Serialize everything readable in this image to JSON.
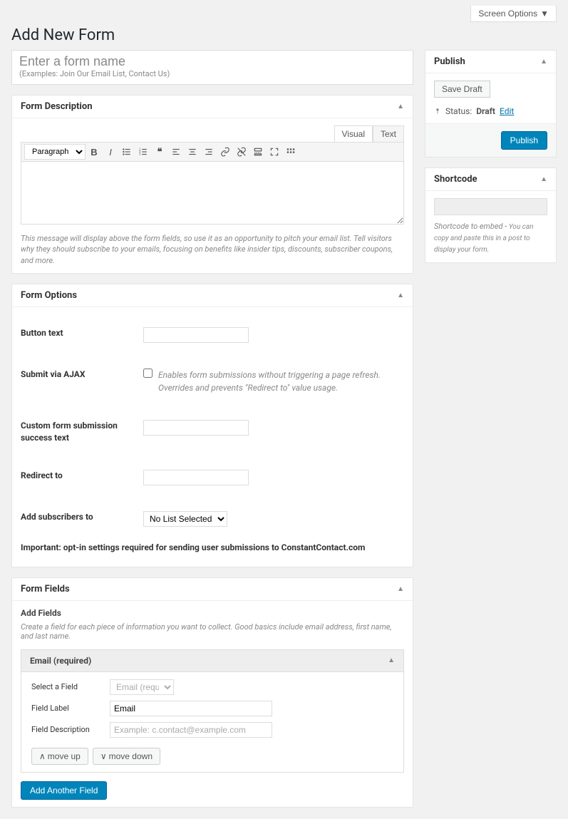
{
  "screen_options_label": "Screen Options",
  "page_title": "Add New Form",
  "title": {
    "placeholder": "Enter a form name",
    "examples": "(Examples: Join Our Email List, Contact Us)"
  },
  "form_description": {
    "heading": "Form Description",
    "tabs": {
      "visual": "Visual",
      "text": "Text"
    },
    "format_option": "Paragraph",
    "hint": "This message will display above the form fields, so use it as an opportunity to pitch your email list. Tell visitors why they should subscribe to your emails, focusing on benefits like insider tips, discounts, subscriber coupons, and more."
  },
  "form_options": {
    "heading": "Form Options",
    "button_text_label": "Button text",
    "ajax_label": "Submit via AJAX",
    "ajax_desc": "Enables form submissions without triggering a page refresh. Overrides and prevents \"Redirect to\" value usage.",
    "success_text_label": "Custom form submission success text",
    "redirect_label": "Redirect to",
    "subscribers_label": "Add subscribers to",
    "subscribers_selected": "No List Selected",
    "important_note": "Important: opt-in settings required for sending user submissions to ConstantContact.com"
  },
  "form_fields": {
    "heading": "Form Fields",
    "add_fields_title": "Add Fields",
    "add_fields_hint": "Create a field for each piece of information you want to collect. Good basics include email address, first name, and last name.",
    "card": {
      "title": "Email (required)",
      "select_label": "Select a Field",
      "select_value": "Email (required)",
      "field_label_label": "Field Label",
      "field_label_value": "Email",
      "field_desc_label": "Field Description",
      "field_desc_placeholder": "Example: c.contact@example.com"
    },
    "move_up": "move up",
    "move_down": "move down",
    "add_another": "Add Another Field"
  },
  "publish": {
    "heading": "Publish",
    "save_draft": "Save Draft",
    "status_label": "Status:",
    "status_value": "Draft",
    "edit": "Edit",
    "publish_btn": "Publish"
  },
  "shortcode": {
    "heading": "Shortcode",
    "hint_lead": "Shortcode to embed - ",
    "hint_rest": "You can copy and paste this in a post to display your form."
  }
}
